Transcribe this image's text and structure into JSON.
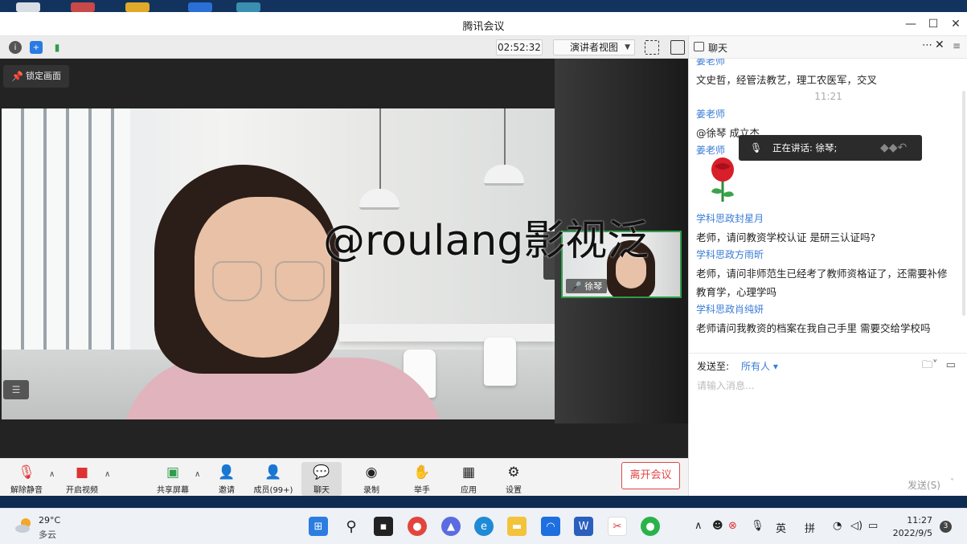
{
  "window": {
    "title": "腾讯会议",
    "controls": {
      "minimize": "—",
      "maximize": "☐",
      "close": "✕"
    }
  },
  "video_toolbar": {
    "timer": "02:52:32",
    "view_mode": "演讲者视图",
    "icons": [
      "info-icon",
      "shield-icon",
      "signal-icon",
      "fullscreen-icon",
      "sidebar-icon"
    ]
  },
  "pin_button": {
    "label": "锁定画面"
  },
  "watermark": "@roulang影视泛",
  "thumbnail": {
    "name": "徐琴"
  },
  "controls": {
    "unmute": "解除静音",
    "start_video": "开启视频",
    "share_screen": "共享屏幕",
    "invite": "邀请",
    "members": "成员(99+)",
    "chat": "聊天",
    "record": "录制",
    "raise_hand": "举手",
    "apps": "应用",
    "settings": "设置",
    "leave": "离开会议"
  },
  "chat": {
    "title": "聊天",
    "first_name": "姜老师",
    "messages": [
      {
        "text": "文史哲，经管法教艺，理工农医军，交叉"
      },
      {
        "time": "11:21"
      },
      {
        "name": "姜老师",
        "text": "@徐琴 成立杰"
      },
      {
        "name": "姜老师",
        "sticker": "rose"
      },
      {
        "name": "学科思政封星月",
        "text": "老师，请问教资学校认证 是研三认证吗?"
      },
      {
        "name": "学科思政方雨昕",
        "text": "老师，请问非师范生已经考了教师资格证了，还需要补修",
        "text2": "教育学，心理学吗"
      },
      {
        "name": "学科思政肖纯妍",
        "text": "老师请问我教资的档案在我自己手里 需要交给学校吗"
      }
    ],
    "speaking": "正在讲话: 徐琴;",
    "send_to_label": "发送至:",
    "send_to_value": "所有人",
    "input_placeholder": "请输入消息...",
    "send_button": "发送(S)"
  },
  "taskbar": {
    "weather_temp": "29°C",
    "weather_desc": "多云",
    "ime_lang": "英",
    "ime_mode": "拼",
    "time": "11:27",
    "date": "2022/9/5",
    "notifications": "3"
  },
  "colors": {
    "accent": "#3a7cd6",
    "leave": "#e04848",
    "thumb_border": "#2f9c4c"
  }
}
